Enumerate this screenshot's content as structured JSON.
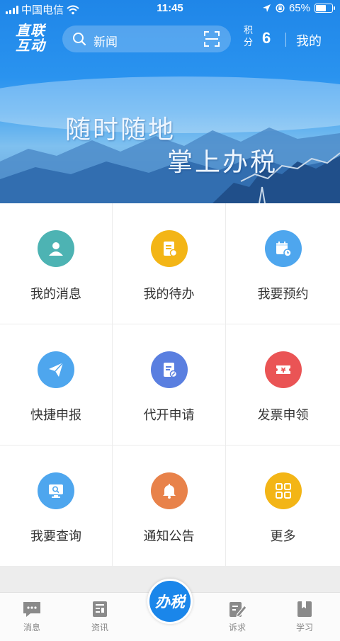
{
  "status_bar": {
    "carrier": "中国电信",
    "time": "11:45",
    "battery": "65%",
    "battery_level": 0.65
  },
  "header": {
    "logo_line1": "直联",
    "logo_line2": "互动",
    "search_text": "新闻",
    "points_label": "积分",
    "points_value": "6",
    "mine_label": "我的"
  },
  "banner": {
    "slogan_line1": "随时随地",
    "slogan_line2": "掌上办税"
  },
  "menu": [
    {
      "label": "我的消息",
      "icon": "user-icon",
      "color": "#4db3b3"
    },
    {
      "label": "我的待办",
      "icon": "document-icon",
      "color": "#f3b516"
    },
    {
      "label": "我要预约",
      "icon": "calendar-clock-icon",
      "color": "#4ea6ee"
    },
    {
      "label": "快捷申报",
      "icon": "paper-plane-icon",
      "color": "#4ea6ee"
    },
    {
      "label": "代开申请",
      "icon": "document-edit-icon",
      "color": "#5a7fe0"
    },
    {
      "label": "发票申领",
      "icon": "invoice-yuan-icon",
      "color": "#ea5455"
    },
    {
      "label": "我要查询",
      "icon": "monitor-search-icon",
      "color": "#4ea6ee"
    },
    {
      "label": "通知公告",
      "icon": "bell-icon",
      "color": "#e8824a"
    },
    {
      "label": "更多",
      "icon": "grid-icon",
      "color": "#f3b516"
    }
  ],
  "tabbar": {
    "tabs": [
      {
        "label": "消息",
        "icon": "chat-icon"
      },
      {
        "label": "资讯",
        "icon": "news-icon"
      },
      {
        "label": "诉求",
        "icon": "edit-icon"
      },
      {
        "label": "学习",
        "icon": "book-icon"
      }
    ],
    "center_label": "办税"
  }
}
